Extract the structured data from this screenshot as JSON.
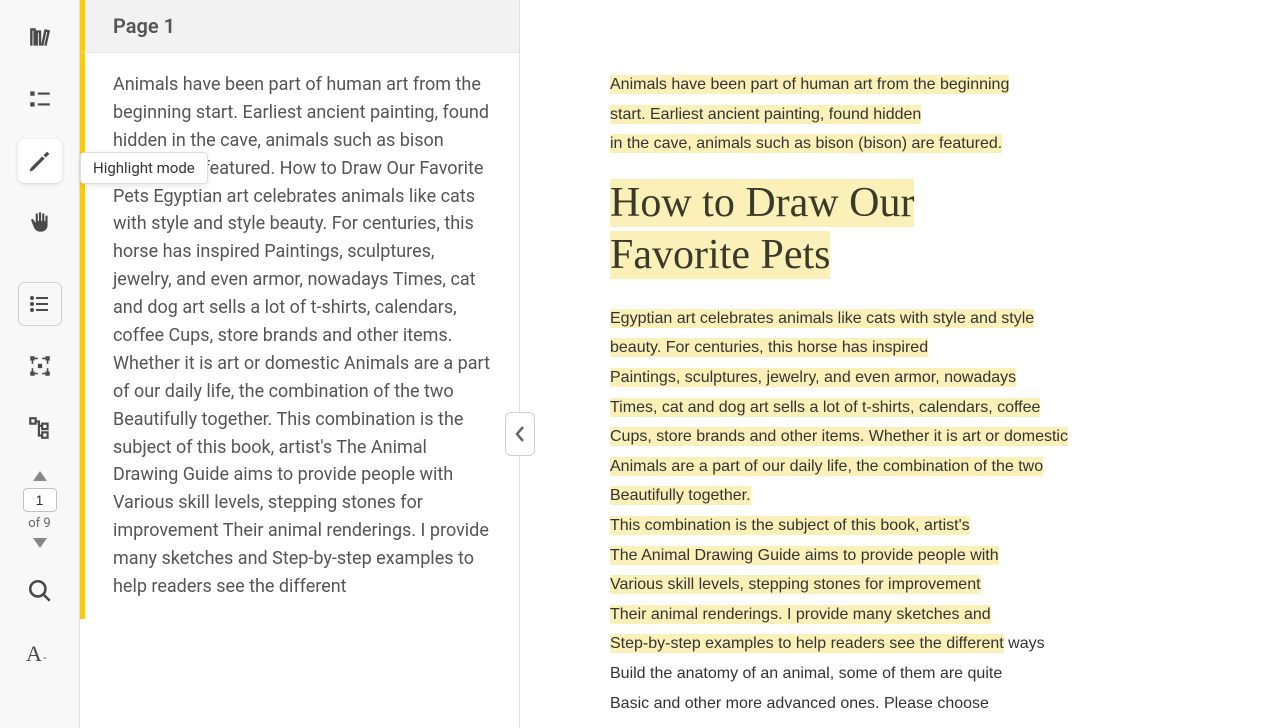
{
  "tooltip": "Highlight mode",
  "panel": {
    "header": "Page 1",
    "body": "Animals have been part of human art from the beginning start. Earliest ancient painting, found hidden in the cave, animals such as bison (bison) are featured. How to Draw Our Favorite Pets Egyptian art celebrates animals like cats with style and style beauty. For centuries, this horse has inspired Paintings, sculptures, jewelry, and even armor, nowadays Times, cat and dog art sells a lot of t-shirts, calendars, coffee Cups, store brands and other items. Whether it is art or domestic Animals are a part of our daily life, the combination of the two Beautifully together. This combination is the subject of this book, artist's The Animal Drawing Guide aims to provide people with Various skill levels, stepping stones for improvement Their animal renderings. I provide many sketches and Step-by-step examples to help readers see the different"
  },
  "pageNav": {
    "current": "1",
    "total": "of 9"
  },
  "doc": {
    "intro1": "Animals have been part of human art from the beginning",
    "intro2": "start. Earliest ancient painting, found hidden",
    "intro3": "in the cave, animals such as bison (bison) are featured.",
    "title1": "How to Draw Our",
    "title2": "Favorite Pets",
    "p1": "Egyptian art celebrates animals like cats with style and style",
    "p2": "beauty. For centuries, this horse has inspired",
    "p3": "Paintings, sculptures, jewelry, and even armor, nowadays",
    "p4": "Times, cat and dog art sells a lot of t-shirts, calendars, coffee",
    "p5": "Cups, store brands and other items. Whether it is art or domestic",
    "p6": "Animals are a part of our daily life, the combination of the two",
    "p7": "Beautifully together.",
    "p8": "This combination is the subject of this book, artist's",
    "p9": "The Animal Drawing Guide aims to provide people with",
    "p10": "Various skill levels, stepping stones for improvement",
    "p11": "Their animal renderings. I provide many sketches and",
    "p12a": "Step-by-step examples to help readers see the different",
    "p12b": " ways",
    "p13": "Build the anatomy of an animal, some of them are quite",
    "p14": "Basic and other more advanced ones. Please choose"
  }
}
